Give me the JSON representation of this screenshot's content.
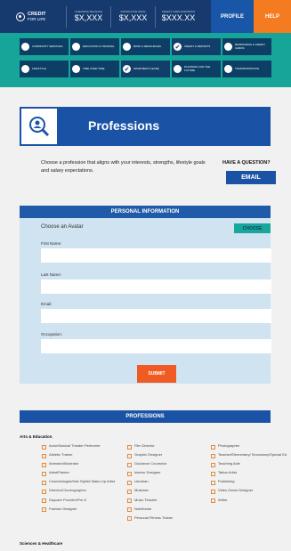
{
  "header": {
    "logo_top": "CREDIT",
    "logo_bottom": "FOR LIFE",
    "stats": [
      {
        "label": "Checking balance",
        "value": "$X,XXX"
      },
      {
        "label": "Savings balance",
        "value": "$X,XXX"
      },
      {
        "label": "Credit card earnings",
        "value": "$XXX.XX"
      }
    ],
    "profile_label": "PROFILE",
    "help_label": "HELP"
  },
  "modules": [
    {
      "label": "Community services",
      "checked": false
    },
    {
      "label": "Education & Training",
      "checked": false
    },
    {
      "label": "Bank & Resources",
      "checked": false
    },
    {
      "label": "Credit & Reports",
      "checked": true
    },
    {
      "label": "Borrowing & Credit Cards",
      "checked": false
    },
    {
      "label": "Lifestyle",
      "checked": false
    },
    {
      "label": "Time Over Time",
      "checked": false
    },
    {
      "label": "Apartment Lease",
      "checked": true
    },
    {
      "label": "Planning for the Future",
      "checked": false
    },
    {
      "label": "Transportation",
      "checked": false
    }
  ],
  "banner": {
    "title": "Professions",
    "icon": "magnifier-person-icon"
  },
  "intro_text": "Choose a profession that aligns with your interests, strengths, lifestyle goals and salary expectations.",
  "question_label": "HAVE A QUESTION?",
  "email_label": "EMAIL",
  "personal_info": {
    "heading": "PERSONAL INFORMATION",
    "avatar_label": "Choose an Avatar",
    "choose_label": "CHOOSE",
    "fields": [
      {
        "label": "First Name:",
        "value": ""
      },
      {
        "label": "Last Name:",
        "value": ""
      },
      {
        "label": "Email:",
        "value": ""
      },
      {
        "label": "Occupation:",
        "value": ""
      }
    ],
    "submit_label": "SUBMIT"
  },
  "professions": {
    "heading": "PROFESSIONS",
    "categories": [
      {
        "name": "Arts & Education",
        "columns": [
          [
            {
              "label": "Actor/Musical Theater Performer"
            },
            {
              "label": "Athletic Trainer"
            },
            {
              "label": "Animator/Illustrator"
            },
            {
              "label": "Artist/Painter"
            },
            {
              "label": "Cosmetologist/Hair Stylist/ Make-Up Artist"
            },
            {
              "label": "Director/Choreographer"
            },
            {
              "label": "Daycare Provider/Pre-K"
            },
            {
              "label": "Fashion Designer"
            }
          ],
          [
            {
              "label": "Film Director"
            },
            {
              "label": "Graphic Designer"
            },
            {
              "label": "Guidance Counselor"
            },
            {
              "label": "Interior Designer"
            },
            {
              "label": "Librarian"
            },
            {
              "label": "Musician"
            },
            {
              "label": "Music Teacher"
            },
            {
              "label": "Nutritionist"
            },
            {
              "label": "Personal Fitness Trainer"
            }
          ],
          [
            {
              "label": "Photographer"
            },
            {
              "label": "Teacher/Elementary/ Secondary/Special Ed"
            },
            {
              "label": "Teaching Aide"
            },
            {
              "label": "Tattoo Artist"
            },
            {
              "label": "Publishing"
            },
            {
              "label": "Video Game Designer"
            },
            {
              "label": "Writer"
            }
          ]
        ]
      },
      {
        "name": "Sciences & Healthcare",
        "columns": []
      }
    ]
  }
}
